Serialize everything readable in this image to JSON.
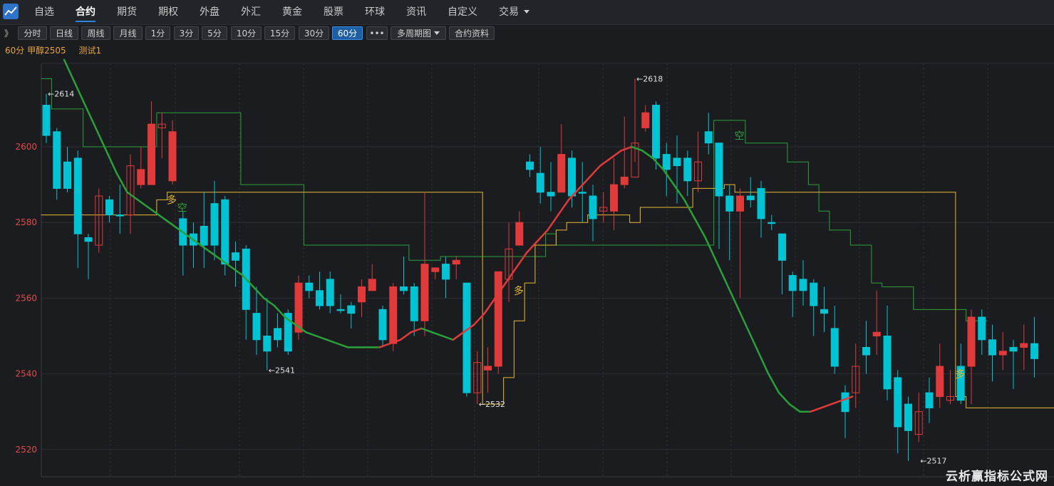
{
  "nav": {
    "items": [
      "自选",
      "合约",
      "期货",
      "期权",
      "外盘",
      "外汇",
      "黄金",
      "股票",
      "环球",
      "资讯",
      "自定义",
      "交易"
    ],
    "active": "合约"
  },
  "toolbar": {
    "expand_label": "》",
    "buttons": [
      "分时",
      "日线",
      "周线",
      "月线",
      "1分",
      "3分",
      "5分",
      "10分",
      "15分",
      "30分",
      "60分",
      "•••",
      "多周期图",
      "合约资料"
    ],
    "active": "60分"
  },
  "info": {
    "period": "60分",
    "contract": "甲醇2505",
    "indicator": "测试1"
  },
  "colors": {
    "up": "#e03a3a",
    "down": "#00c4d4",
    "ma_up": "#e03a3a",
    "ma_down": "#2aa038",
    "support": "#e6b830",
    "resistance": "#2aa038",
    "grid": "#2c2d33"
  },
  "chart_data": {
    "type": "candlestick",
    "yaxis_ticks": [
      2520,
      2540,
      2560,
      2580,
      2600
    ],
    "ylim": [
      2514,
      2622
    ],
    "candles": [
      [
        2611,
        2603,
        2614,
        2601
      ],
      [
        2604,
        2589,
        2605,
        2586
      ],
      [
        2596,
        2589,
        2600,
        2588
      ],
      [
        2597,
        2577,
        2599,
        2568
      ],
      [
        2576,
        2575,
        2577,
        2565
      ],
      [
        2574,
        2587,
        2589,
        2572
      ],
      [
        2586,
        2582,
        2587,
        2580
      ],
      [
        2582,
        2582,
        2590,
        2577
      ],
      [
        2582,
        2595,
        2598,
        2577
      ],
      [
        2590,
        2594,
        2600,
        2589
      ],
      [
        2590,
        2606,
        2612,
        2590
      ],
      [
        2605,
        2606,
        2609,
        2597
      ],
      [
        2591,
        2604,
        2607,
        2590
      ],
      [
        2581,
        2574,
        2583,
        2566
      ],
      [
        2577,
        2574,
        2580,
        2568
      ],
      [
        2579,
        2574,
        2588,
        2568
      ],
      [
        2585,
        2574,
        2591,
        2570
      ],
      [
        2586,
        2569,
        2587,
        2566
      ],
      [
        2572,
        2570,
        2575,
        2563
      ],
      [
        2573,
        2557,
        2574,
        2549
      ],
      [
        2556,
        2549,
        2563,
        2545
      ],
      [
        2550,
        2546,
        2560,
        2541
      ],
      [
        2552,
        2549,
        2556,
        2547
      ],
      [
        2556,
        2546,
        2557,
        2545
      ],
      [
        2551,
        2564,
        2566,
        2549
      ],
      [
        2564,
        2562,
        2566,
        2560
      ],
      [
        2562,
        2558,
        2567,
        2557
      ],
      [
        2565,
        2558,
        2567,
        2556
      ],
      [
        2557,
        2557,
        2561,
        2556
      ],
      [
        2558,
        2556,
        2559,
        2552
      ],
      [
        2559,
        2563,
        2565,
        2555
      ],
      [
        2562,
        2565,
        2569,
        2562
      ],
      [
        2557,
        2549,
        2558,
        2547
      ],
      [
        2548,
        2563,
        2564,
        2546
      ],
      [
        2563,
        2562,
        2571,
        2561
      ],
      [
        2563,
        2554,
        2564,
        2550
      ],
      [
        2554,
        2569,
        2588,
        2550
      ],
      [
        2567,
        2568,
        2568,
        2565
      ],
      [
        2569,
        2565,
        2571,
        2560
      ],
      [
        2569,
        2570,
        2571,
        2565
      ],
      [
        2564,
        2535,
        2564,
        2534
      ],
      [
        2535,
        2543,
        2546,
        2532
      ],
      [
        2541,
        2542,
        2547,
        2535
      ],
      [
        2542,
        2567,
        2567,
        2540
      ],
      [
        2565,
        2573,
        2580,
        2559
      ],
      [
        2574,
        2580,
        2583,
        2575
      ],
      [
        2596,
        2594,
        2598,
        2592
      ],
      [
        2593,
        2588,
        2600,
        2585
      ],
      [
        2588,
        2587,
        2596,
        2583
      ],
      [
        2588,
        2598,
        2606,
        2588
      ],
      [
        2597,
        2587,
        2599,
        2584
      ],
      [
        2588,
        2588,
        2596,
        2580
      ],
      [
        2587,
        2581,
        2590,
        2575
      ],
      [
        2583,
        2584,
        2588,
        2580
      ],
      [
        2583,
        2590,
        2597,
        2578
      ],
      [
        2590,
        2592,
        2608,
        2589
      ],
      [
        2592,
        2601,
        2618,
        2596
      ],
      [
        2605,
        2609,
        2611,
        2604
      ],
      [
        2611,
        2597,
        2612,
        2594
      ],
      [
        2598,
        2594,
        2601,
        2587
      ],
      [
        2597,
        2595,
        2603,
        2585
      ],
      [
        2597,
        2591,
        2599,
        2587
      ],
      [
        2591,
        2596,
        2604,
        2588
      ],
      [
        2604,
        2601,
        2609,
        2598
      ],
      [
        2601,
        2587,
        2601,
        2573
      ],
      [
        2587,
        2583,
        2590,
        2570
      ],
      [
        2583,
        2587,
        2589,
        2560
      ],
      [
        2587,
        2586,
        2592,
        2584
      ],
      [
        2589,
        2581,
        2591,
        2576
      ],
      [
        2580,
        2580,
        2582,
        2578
      ],
      [
        2577,
        2570,
        2577,
        2561
      ],
      [
        2566,
        2562,
        2567,
        2555
      ],
      [
        2565,
        2562,
        2570,
        2558
      ],
      [
        2564,
        2558,
        2565,
        2550
      ],
      [
        2557,
        2556,
        2563,
        2551
      ],
      [
        2552,
        2542,
        2558,
        2540
      ],
      [
        2535,
        2530,
        2537,
        2523
      ],
      [
        2535,
        2542,
        2548,
        2531
      ],
      [
        2547,
        2545,
        2554,
        2540
      ],
      [
        2550,
        2551,
        2562,
        2545
      ],
      [
        2550,
        2536,
        2558,
        2533
      ],
      [
        2539,
        2526,
        2541,
        2519
      ],
      [
        2532,
        2525,
        2534,
        2517
      ],
      [
        2524,
        2530,
        2535,
        2522
      ],
      [
        2535,
        2531,
        2539,
        2527
      ],
      [
        2534,
        2542,
        2548,
        2531
      ],
      [
        2533,
        2534,
        2541,
        2532
      ],
      [
        2542,
        2533,
        2548,
        2532
      ],
      [
        2542,
        2555,
        2557,
        2532
      ],
      [
        2555,
        2549,
        2557,
        2545
      ],
      [
        2549,
        2545,
        2553,
        2538
      ],
      [
        2545,
        2546,
        2551,
        2541
      ],
      [
        2547,
        2546,
        2549,
        2536
      ],
      [
        2547,
        2548,
        2553,
        2541
      ],
      [
        2548,
        2544,
        2555,
        2539
      ]
    ],
    "ma": [
      2623,
      2617,
      2611,
      2605,
      2599,
      2593,
      2588,
      2586,
      2584,
      2582,
      2580,
      2578,
      2576,
      2574,
      2572,
      2570,
      2568,
      2566,
      2563,
      2560,
      2558,
      2555,
      2553,
      2551,
      2550,
      2549,
      2548,
      2547,
      2547,
      2547,
      2547,
      2548,
      2549,
      2551,
      2552,
      2551,
      2550,
      2549,
      2551,
      2553,
      2556,
      2560,
      2564,
      2568,
      2572,
      2575,
      2578,
      2582,
      2586,
      2589,
      2592,
      2595,
      2597,
      2599,
      2600,
      2599,
      2597,
      2594,
      2590,
      2586,
      2581,
      2576,
      2570,
      2564,
      2558,
      2552,
      2546,
      2540,
      2535,
      2532,
      2530,
      2530,
      2531,
      2532,
      2533,
      2534
    ],
    "ma_x_offset": 18,
    "support": [
      [
        0,
        2582
      ],
      [
        11,
        2586
      ],
      [
        12,
        2588
      ],
      [
        13,
        2588
      ],
      [
        42,
        2532
      ],
      [
        43,
        2532
      ],
      [
        44,
        2539
      ],
      [
        45,
        2554
      ],
      [
        46,
        2564
      ],
      [
        47,
        2574
      ],
      [
        49,
        2578
      ],
      [
        50,
        2580
      ],
      [
        52,
        2582
      ],
      [
        56,
        2580
      ],
      [
        57,
        2584
      ],
      [
        62,
        2589
      ],
      [
        65,
        2590
      ],
      [
        66,
        2588
      ],
      [
        68,
        2588
      ],
      [
        87,
        2534
      ],
      [
        88,
        2531
      ],
      [
        97,
        2530
      ]
    ],
    "resistance": [
      [
        0,
        2618
      ],
      [
        1,
        2610
      ],
      [
        4,
        2600
      ],
      [
        10,
        2600
      ],
      [
        11,
        2609
      ],
      [
        18,
        2609
      ],
      [
        19,
        2590
      ],
      [
        24,
        2590
      ],
      [
        25,
        2574
      ],
      [
        34,
        2574
      ],
      [
        35,
        2570
      ],
      [
        38,
        2571
      ],
      [
        48,
        2577
      ],
      [
        49,
        2574
      ],
      [
        64,
        2607
      ],
      [
        67,
        2601
      ],
      [
        71,
        2596
      ],
      [
        73,
        2590
      ],
      [
        74,
        2583
      ],
      [
        75,
        2578
      ],
      [
        77,
        2574
      ],
      [
        79,
        2564
      ],
      [
        80,
        2563
      ],
      [
        83,
        2557
      ],
      [
        88,
        2554
      ],
      [
        89,
        2554
      ]
    ],
    "signals": [
      {
        "i": 12,
        "text": "多",
        "type": "buy",
        "price": 2585
      },
      {
        "i": 13,
        "text": "空",
        "type": "sell",
        "price": 2583
      },
      {
        "i": 45,
        "text": "多",
        "type": "buy",
        "price": 2561
      },
      {
        "i": 66,
        "text": "空",
        "type": "sell",
        "price": 2602
      },
      {
        "i": 87,
        "text": "多",
        "type": "buy",
        "price": 2539
      }
    ],
    "hilo_labels": [
      {
        "i": 0,
        "text": "←2614",
        "price": 2614
      },
      {
        "i": 21,
        "text": "←2541",
        "price": 2541
      },
      {
        "i": 41,
        "text": "←2532",
        "price": 2532
      },
      {
        "i": 56,
        "text": "←2618",
        "price": 2618
      },
      {
        "i": 83,
        "text": "←2517",
        "price": 2517
      }
    ]
  },
  "watermark": "云析赢指标公式网"
}
